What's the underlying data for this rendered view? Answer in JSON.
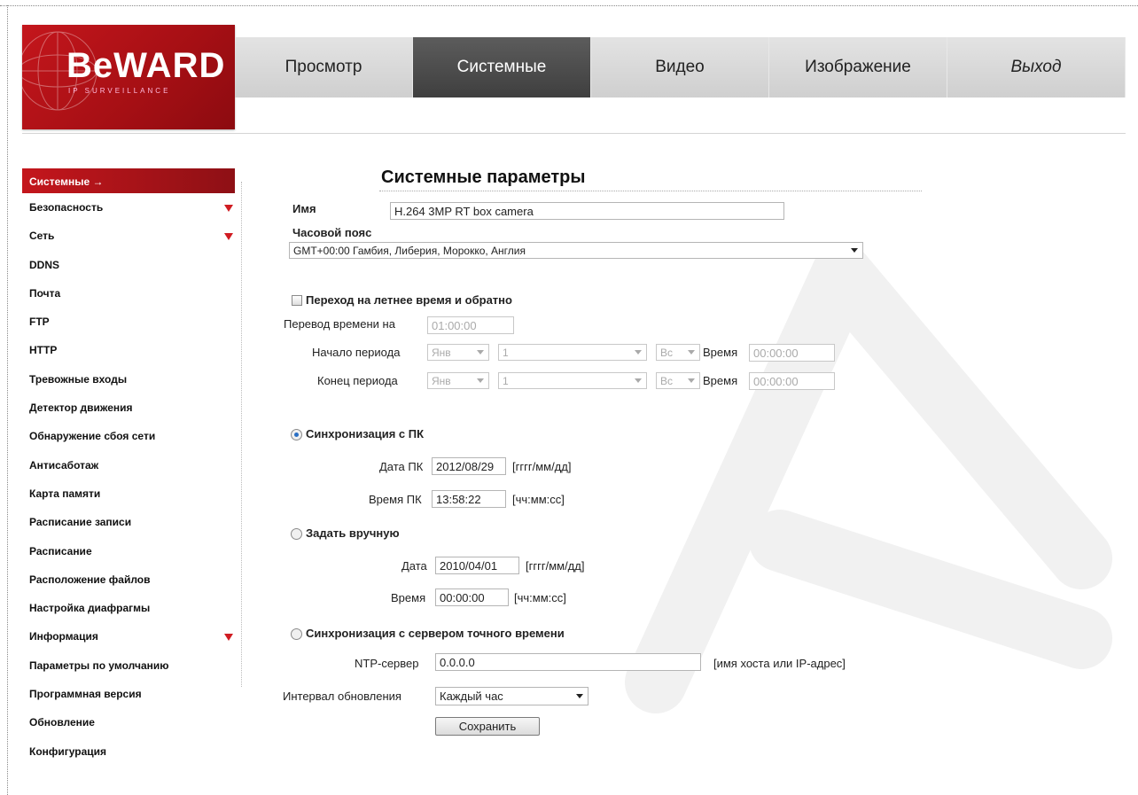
{
  "brand": {
    "logo_text": "BeWARD",
    "logo_subtitle": "IP SURVEILLANCE"
  },
  "nav": {
    "items": [
      {
        "label": "Просмотр"
      },
      {
        "label": "Системные"
      },
      {
        "label": "Видео"
      },
      {
        "label": "Изображение"
      },
      {
        "label": "Выход"
      }
    ],
    "active_index": 1
  },
  "sidebar": {
    "items": [
      {
        "label": "Системные",
        "suffix": "→"
      },
      {
        "label": "Безопасность"
      },
      {
        "label": "Сеть"
      },
      {
        "label": "DDNS"
      },
      {
        "label": "Почта"
      },
      {
        "label": "FTP"
      },
      {
        "label": "HTTP"
      },
      {
        "label": "Тревожные входы"
      },
      {
        "label": "Детектор движения"
      },
      {
        "label": "Обнаружение сбоя сети"
      },
      {
        "label": "Антисаботаж"
      },
      {
        "label": "Карта памяти"
      },
      {
        "label": "Расписание записи"
      },
      {
        "label": "Расписание"
      },
      {
        "label": "Расположение файлов"
      },
      {
        "label": "Настройка диафрагмы"
      },
      {
        "label": "Информация"
      },
      {
        "label": "Параметры по умолчанию"
      },
      {
        "label": "Программная версия"
      },
      {
        "label": "Обновление"
      },
      {
        "label": "Конфигурация"
      }
    ]
  },
  "form": {
    "title": "Системные параметры",
    "name_label": "Имя",
    "name_value": "H.264 3MP RT box camera",
    "timezone_label": "Часовой пояс",
    "timezone_value": "GMT+00:00 Гамбия, Либерия, Морокко, Англия",
    "dst": {
      "label": "Переход на летнее время и обратно",
      "offset_label": "Перевод времени на",
      "offset_value": "01:00:00",
      "start_label": "Начало периода",
      "end_label": "Конец периода",
      "month_value": "Янв",
      "week_value": "1",
      "day_value": "Вс",
      "time_label": "Время",
      "time_value": "00:00:00"
    },
    "sync_pc": {
      "label": "Синхронизация с ПК",
      "date_label": "Дата ПК",
      "date_value": "2012/08/29",
      "date_hint": "[гггг/мм/дд]",
      "time_label": "Время ПК",
      "time_value": "13:58:22",
      "time_hint": "[чч:мм:сс]"
    },
    "manual": {
      "label": "Задать вручную",
      "date_label": "Дата",
      "date_value": "2010/04/01",
      "date_hint": "[гггг/мм/дд]",
      "time_label": "Время",
      "time_value": "00:00:00",
      "time_hint": "[чч:мм:сс]"
    },
    "ntp": {
      "label": "Синхронизация с сервером точного времени",
      "server_label": "NTP-сервер",
      "server_value": "0.0.0.0",
      "server_hint": "[имя хоста или IP-адрес]",
      "interval_label": "Интервал обновления",
      "interval_value": "Каждый час"
    },
    "save_label": "Сохранить"
  },
  "colors": {
    "brand_red": "#c4161c",
    "nav_active": "#4a4a4a",
    "radio_accent": "#2a6fc4"
  }
}
